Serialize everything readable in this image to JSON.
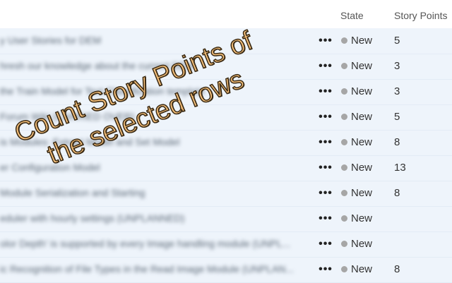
{
  "columns": {
    "state": "State",
    "story_points": "Story Points"
  },
  "rows": [
    {
      "title": "y User Stories for DEM",
      "state": "New",
      "story_points": "5"
    },
    {
      "title": "hresh our knowledge about the current DEM",
      "state": "New",
      "story_points": "3"
    },
    {
      "title": "the Train Model for Text Classification template",
      "state": "New",
      "story_points": "3"
    },
    {
      "title": "Forum Wiki (CARRIED OVER)",
      "state": "New",
      "story_points": "5"
    },
    {
      "title": "is Modules: Extract Model and Set Model",
      "state": "New",
      "story_points": "8"
    },
    {
      "title": "er Configuration Model",
      "state": "New",
      "story_points": "13"
    },
    {
      "title": "Module Serialization and Starting",
      "state": "New",
      "story_points": "8"
    },
    {
      "title": "eduler with hourly settings (UNPLANNED)",
      "state": "New",
      "story_points": ""
    },
    {
      "title": "olor Depth' is supported by every Image handling module (UNPL...",
      "state": "New",
      "story_points": ""
    },
    {
      "title": "ic Recognition of File Types in the Read Image Module (UNPLAN...",
      "state": "New",
      "story_points": "8"
    }
  ],
  "more_icon": "ellipsis-icon",
  "state_colors": {
    "new": "#a6a6a6"
  },
  "overlay": {
    "line1": "Count Story Points of",
    "line2": "the selected rows"
  }
}
